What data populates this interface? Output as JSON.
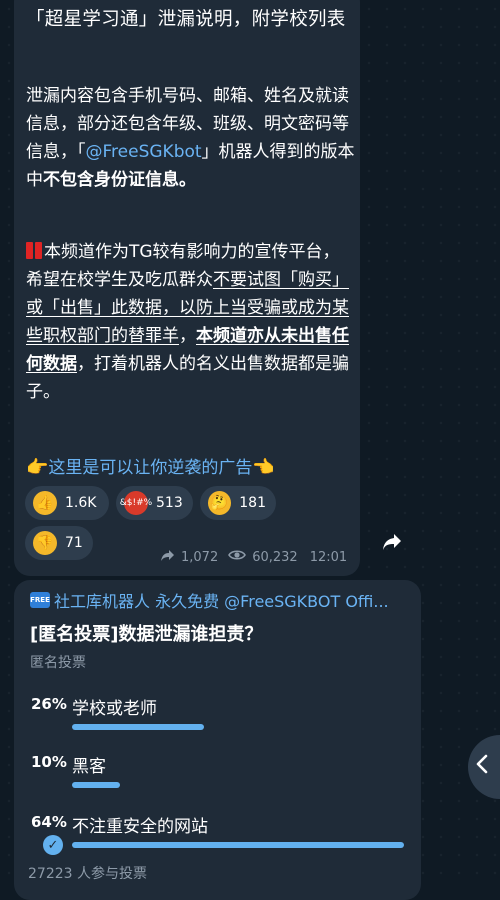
{
  "message": {
    "title": "「超星学习通」泄漏说明，附学校列表",
    "p1": {
      "a": "泄漏内容包含手机号码、邮箱、姓名及就读信息，部分还包含年级、班级、明文密码等信息，「",
      "mention": "@FreeSGKbot",
      "b": "」机器人得到的版本中",
      "bold": "不包含身份证信息。"
    },
    "p2": {
      "a": "本频道作为TG较有影响力的宣传平台，希望在校学生及吃瓜群众",
      "u1": "不要试图「购买」或「出售」此数据，以防上当受骗或成为某些职权部门的替罪羊",
      "c": "，",
      "bold_u": "本频道亦从未出售任何数据",
      "d": "，打着机器人的名义出售数据都是骗子。"
    },
    "p3": {
      "hand_left": "👉",
      "text": "这里是可以让你逆袭的广告",
      "hand_right": "👈"
    },
    "reactions": [
      {
        "emoji": "👍",
        "count": "1.6K"
      },
      {
        "emoji": "&$!#%",
        "count": "513"
      },
      {
        "emoji": "🤔",
        "count": "181"
      },
      {
        "emoji": "👎",
        "count": "71"
      }
    ],
    "shares": "1,072",
    "views": "60,232",
    "time": "12:01",
    "icons": {
      "share_count": "share-arrow-icon",
      "views": "eye-icon",
      "forward": "forward-icon"
    }
  },
  "poll": {
    "badge": "FREE",
    "header": "社工库机器人 永久免费 @FreeSGKBOT Offi...",
    "question": "[匿名投票]数据泄漏谁担责？",
    "type": "匿名投票",
    "options": [
      {
        "pct": "26%",
        "label": "学校或老师",
        "value": 26
      },
      {
        "pct": "10%",
        "label": "黑客",
        "value": 10
      },
      {
        "pct": "64%",
        "label": "不注重安全的网站",
        "value": 64,
        "chosen": true
      }
    ],
    "voters": "27223 人参与投票"
  },
  "colors": {
    "bubble": "#1f2b38",
    "accent": "#63b1ef",
    "link": "#6ab3f3",
    "muted": "#8d9aa8"
  }
}
